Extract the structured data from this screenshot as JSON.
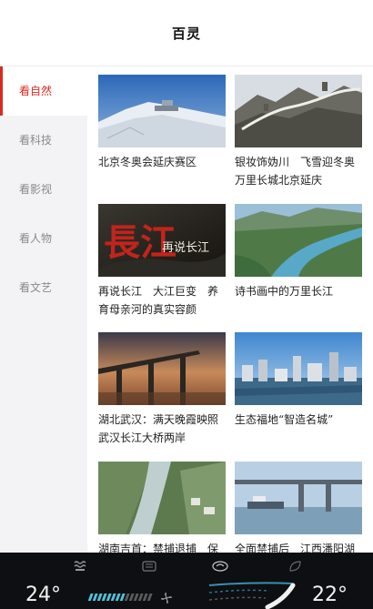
{
  "header": {
    "title": "百灵"
  },
  "sidebar": {
    "items": [
      {
        "label": "看自然",
        "active": true
      },
      {
        "label": "看科技",
        "active": false
      },
      {
        "label": "看影视",
        "active": false
      },
      {
        "label": "看人物",
        "active": false
      },
      {
        "label": "看文艺",
        "active": false
      }
    ]
  },
  "cards": [
    {
      "caption": "北京冬奥会延庆赛区"
    },
    {
      "caption": "银妆饰妫川　飞雪迎冬奥\n万里长城北京延庆"
    },
    {
      "caption": "再说长江　大江巨变　养育母亲河的真实容颜",
      "image_text": {
        "big": "長江",
        "small": "再说长江"
      }
    },
    {
      "caption": "诗书画中的万里长江"
    },
    {
      "caption": "湖北武汉：满天晚霞映照武汉长江大桥两岸"
    },
    {
      "caption": "生态福地“智造名城”"
    },
    {
      "caption": "湖南吉首：禁捕退捕　保"
    },
    {
      "caption": "全面禁捕后　江西潘阳湖"
    }
  ],
  "climate": {
    "left_temp": "24°",
    "right_temp": "22°",
    "icons": [
      "seat-heat-icon",
      "rear-defrost-icon",
      "fan-mode-icon",
      "recirculation-icon",
      "leaf-icon"
    ]
  },
  "colors": {
    "accent": "#d92b20",
    "sidebar_bg": "#f3f3f5",
    "climate_bg": "#0e0f12"
  }
}
